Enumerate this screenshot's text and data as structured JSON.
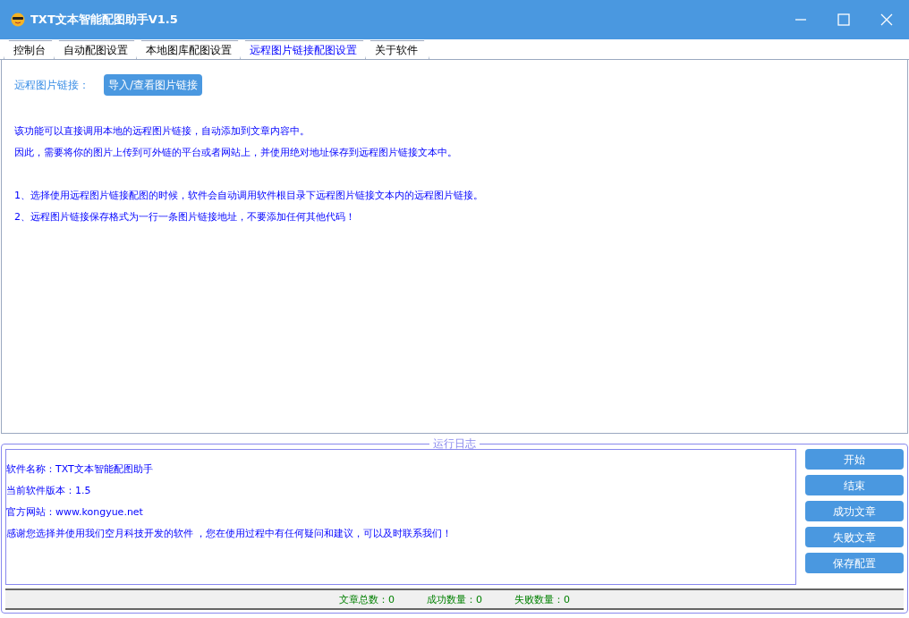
{
  "window": {
    "title": "TXT文本智能配图助手V1.5"
  },
  "tabs": [
    {
      "label": "控制台",
      "selected": false
    },
    {
      "label": "自动配图设置",
      "selected": false
    },
    {
      "label": "本地图库配图设置",
      "selected": false
    },
    {
      "label": "远程图片链接配图设置",
      "selected": true
    },
    {
      "label": "关于软件",
      "selected": false
    }
  ],
  "remote_link": {
    "label": "远程图片链接：",
    "button": "导入/查看图片链接"
  },
  "description": [
    "该功能可以直接调用本地的远程图片链接，自动添加到文章内容中。",
    "因此，需要将你的图片上传到可外链的平台或者网站上，并使用绝对地址保存到远程图片链接文本中。"
  ],
  "notes": [
    "1、选择使用远程图片链接配图的时候，软件会自动调用软件根目录下远程图片链接文本内的远程图片链接。",
    "2、远程图片链接保存格式为一行一条图片链接地址，不要添加任何其他代码！"
  ],
  "log": {
    "title": "运行日志",
    "lines": [
      "软件名称：TXT文本智能配图助手",
      "当前软件版本：1.5",
      "官方网站：www.kongyue.net",
      "感谢您选择并使用我们空月科技开发的软件 ，您在使用过程中有任何疑问和建议，可以及时联系我们！"
    ]
  },
  "buttons": [
    "开始",
    "结束",
    "成功文章",
    "失败文章",
    "保存配置"
  ],
  "status_bar": [
    "文章总数：0",
    "成功数量：0",
    "失败数量：0"
  ]
}
